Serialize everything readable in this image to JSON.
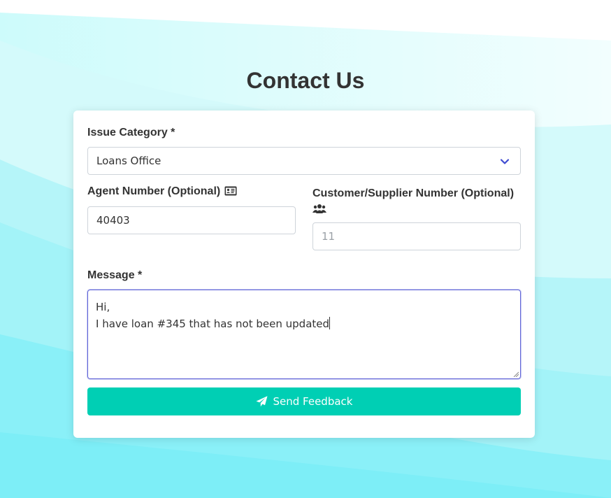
{
  "page": {
    "title": "Contact Us"
  },
  "form": {
    "issue_category": {
      "label": "Issue Category *",
      "value": "Loans Office"
    },
    "agent_number": {
      "label": "Agent Number (Optional)",
      "value": "40403",
      "icon": "id-card-icon"
    },
    "customer_number": {
      "label": "Customer/Supplier Number (Optional)",
      "placeholder": "11",
      "icon": "users-icon"
    },
    "message": {
      "label": "Message *",
      "line1": "Hi,",
      "line2": "I have loan #345 that has not been updated"
    },
    "submit": {
      "label": "Send Feedback",
      "icon": "paper-plane-icon"
    }
  },
  "colors": {
    "accent": "#00cfb4",
    "focus": "#6266d8",
    "background_wave": "#7ff0fa"
  }
}
